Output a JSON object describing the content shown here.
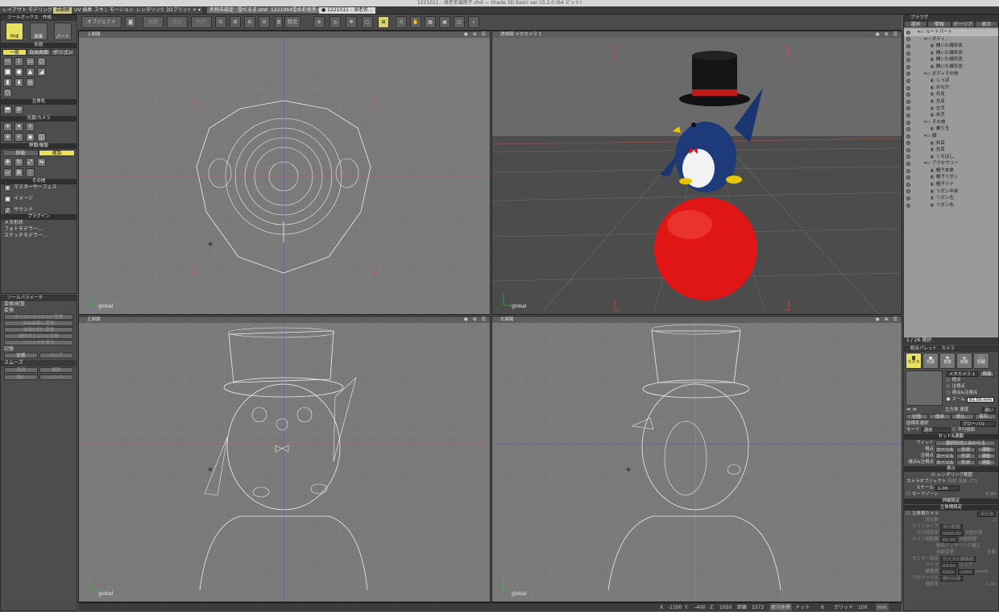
{
  "window_title": "1221011 - 海老名端郎子.shd — Shade 3D Basic ver.15.2.0 (64 ビット)",
  "app_tabs": [
    {
      "label": "レイアウト",
      "active": false
    },
    {
      "label": "モデリング",
      "active": false
    },
    {
      "label": "自動断",
      "active": true
    },
    {
      "label": "UV 編集",
      "active": false
    },
    {
      "label": "スキン",
      "active": false
    },
    {
      "label": "モーション",
      "active": false
    },
    {
      "label": "レンダリング",
      "active": false
    },
    {
      "label": "3Dプリント",
      "active": false
    },
    {
      "label": "+ ▾",
      "active": false
    }
  ],
  "doc_tabs": [
    {
      "label": "名称未設定",
      "active": false
    },
    {
      "label": "雪だるま.shd",
      "active": false
    },
    {
      "label": "1221064雪永彩夜里.shd",
      "active": false
    },
    {
      "label": "● 1221011 - 海老名...",
      "active": true
    }
  ],
  "toolbar": {
    "object_label": "オブジェクト",
    "btn_a": "面面",
    "btn_b": "統合",
    "btn_c": "削除",
    "btn_merge": "統合"
  },
  "toolbox": {
    "title": "ツールボックス　作成",
    "big_tools": [
      "作成",
      "編集",
      "パート"
    ],
    "shape_section": "形状",
    "shape_tabs": [
      "一般",
      "自由曲面",
      "ポリゴン"
    ],
    "solidify_section": "立体化",
    "light_camera_section": "光源/カメラ",
    "move_section": "移動/複製",
    "move_tabs": [
      "移動",
      "複製"
    ],
    "other_section": "その他",
    "other_items": [
      "マスターサーフェス",
      "イメージ",
      "サウンド"
    ],
    "plugin_section": "プラグイン",
    "plugin_items": [
      "メタ形状",
      "フォトモデラー...",
      "スケッチモデラー..."
    ]
  },
  "tool_params": {
    "title": "ツールパラメータ",
    "subtitle": "変換/配置",
    "group_convert": "変換",
    "convert_buttons": [
      "ポリゴンメッシュに変換",
      "自由曲面に変換",
      "曲面分割に変換",
      "線形ポリゴンに変換",
      "ソリッドを表示"
    ],
    "group_record": "記憶",
    "record_buttons": [
      "記憶",
      "クリア"
    ],
    "group_smooth": "スムーズ",
    "smooth_buttons": [
      "適用",
      "解除",
      "縮小",
      "リンク"
    ]
  },
  "viewports": [
    {
      "label": "上面図",
      "footer": "global"
    },
    {
      "label": "透視図  メタカメラ 1",
      "footer": "global"
    },
    {
      "label": "正面図",
      "footer": "global"
    },
    {
      "label": "右面図",
      "footer": "global"
    }
  ],
  "browser": {
    "title": "ブラウザ",
    "tabs": [
      "選択",
      "情報",
      "グーリアン",
      "表示"
    ],
    "tree": [
      {
        "label": "ルートパート",
        "depth": 0
      },
      {
        "label": "ボディ",
        "depth": 1
      },
      {
        "label": "開いた線形状",
        "depth": 2
      },
      {
        "label": "開いた線形状",
        "depth": 2
      },
      {
        "label": "開いた線形状",
        "depth": 2
      },
      {
        "label": "開いた線形状",
        "depth": 2
      },
      {
        "label": "ボディその他",
        "depth": 1
      },
      {
        "label": "しっぽ",
        "depth": 2
      },
      {
        "label": "おなか",
        "depth": 2
      },
      {
        "label": "右足",
        "depth": 2
      },
      {
        "label": "左足",
        "depth": 2
      },
      {
        "label": "左手",
        "depth": 2
      },
      {
        "label": "右手",
        "depth": 2
      },
      {
        "label": "その他",
        "depth": 1
      },
      {
        "label": "乗り玉",
        "depth": 2
      },
      {
        "label": "顔",
        "depth": 1
      },
      {
        "label": "右目",
        "depth": 2
      },
      {
        "label": "左目",
        "depth": 2
      },
      {
        "label": "くちばし",
        "depth": 2
      },
      {
        "label": "アクセサリー",
        "depth": 1
      },
      {
        "label": "帽子本体",
        "depth": 2
      },
      {
        "label": "帽子リボン",
        "depth": 2
      },
      {
        "label": "帽子ツナ",
        "depth": 2
      },
      {
        "label": "リボン中央",
        "depth": 2
      },
      {
        "label": "リボン左",
        "depth": 2
      },
      {
        "label": "リボン右",
        "depth": 2
      }
    ],
    "footer": "1 / 26 選択"
  },
  "camera_panel": {
    "title": "統合パレット　カメラ",
    "icons": [
      "カメラ",
      "光源",
      "背景",
      "材質",
      "情報"
    ],
    "camera_name": "メタカメラ 1",
    "info_btn": "情報",
    "radios": [
      "視点",
      "注視点",
      "視点&注視点",
      "ズーム"
    ],
    "zoom_value": "81.56 mm",
    "stereo_label": "立方体  速度",
    "speed_value": "遅い",
    "buttons": [
      "記憶",
      "復帰",
      "読込...",
      "保存..."
    ],
    "coord_label": "座標系選択",
    "coord_value": "グローバル",
    "mode_label": "モード",
    "mode_value": "通常",
    "parallel_label": "平行投影",
    "set_section": "セット&連動",
    "fit_label": "フィット",
    "fit_button": "選択形状に合わせる",
    "rows": [
      {
        "label": "視点",
        "a": "カーソル",
        "b": "形状",
        "c": "連動"
      },
      {
        "label": "注視点",
        "a": "カーソル",
        "b": "形状",
        "c": "連動"
      },
      {
        "label": "視点&注視点",
        "a": "カーソル",
        "b": "形状",
        "c": "連動"
      }
    ],
    "display_section": "表示",
    "render_range": "レンダリング範囲",
    "camera_object_label": "カメラオブジェクト",
    "camera_object_opts": [
      "形状",
      "名前",
      "パス"
    ],
    "scale_label": "スケール",
    "scale_value": "1.00",
    "safe_zone": "セーフゾーン",
    "safe_value": "0.90",
    "detail_section": "詳細設定",
    "stereo_section": "立体視設定",
    "stereo_camera": "立体視カメラ",
    "stereo_mode": "平行法",
    "view_count_label": "視点数",
    "view_count_value": "2",
    "camera_type_label": "カメラタイプ",
    "camera_type_value": "平行配置",
    "zero_plane_label": "ゼロ視差面",
    "zero_plane_value": "5000.00",
    "eye_dist_label": "カメラ間距離",
    "eye_dist_value": "60.00",
    "auto_calc": "自動計算",
    "auto_adjust": "自動調整",
    "collision": "衝突ジッタリング補正",
    "auto_setting": "自動変更",
    "all_label": "全般",
    "monitor_label": "モニター設定",
    "monitor_value": "サイズと解像度",
    "size_label": "サイズ",
    "size_value": "23.60",
    "size_unit": "インチ",
    "res_label": "解像度",
    "res_w": "1920",
    "res_h": "1080",
    "res_unit": "pixels",
    "profile_label": "プロファイル",
    "profile_value": "現行の値",
    "extra_label": "視差率",
    "extra_value": "1.00"
  },
  "statusbar": {
    "x_label": "X",
    "x_value": "-1100",
    "y_label": "Y",
    "y_value": "-400",
    "z_label": "Z",
    "z_value": "1050",
    "alt_label": "距離",
    "alt_value": "1572",
    "abs_label": "絶対座標",
    "dot_label": "ドット",
    "dot_value": "6",
    "grid_label": "グリッド",
    "grid_value": "100",
    "unit_value": "mm"
  }
}
